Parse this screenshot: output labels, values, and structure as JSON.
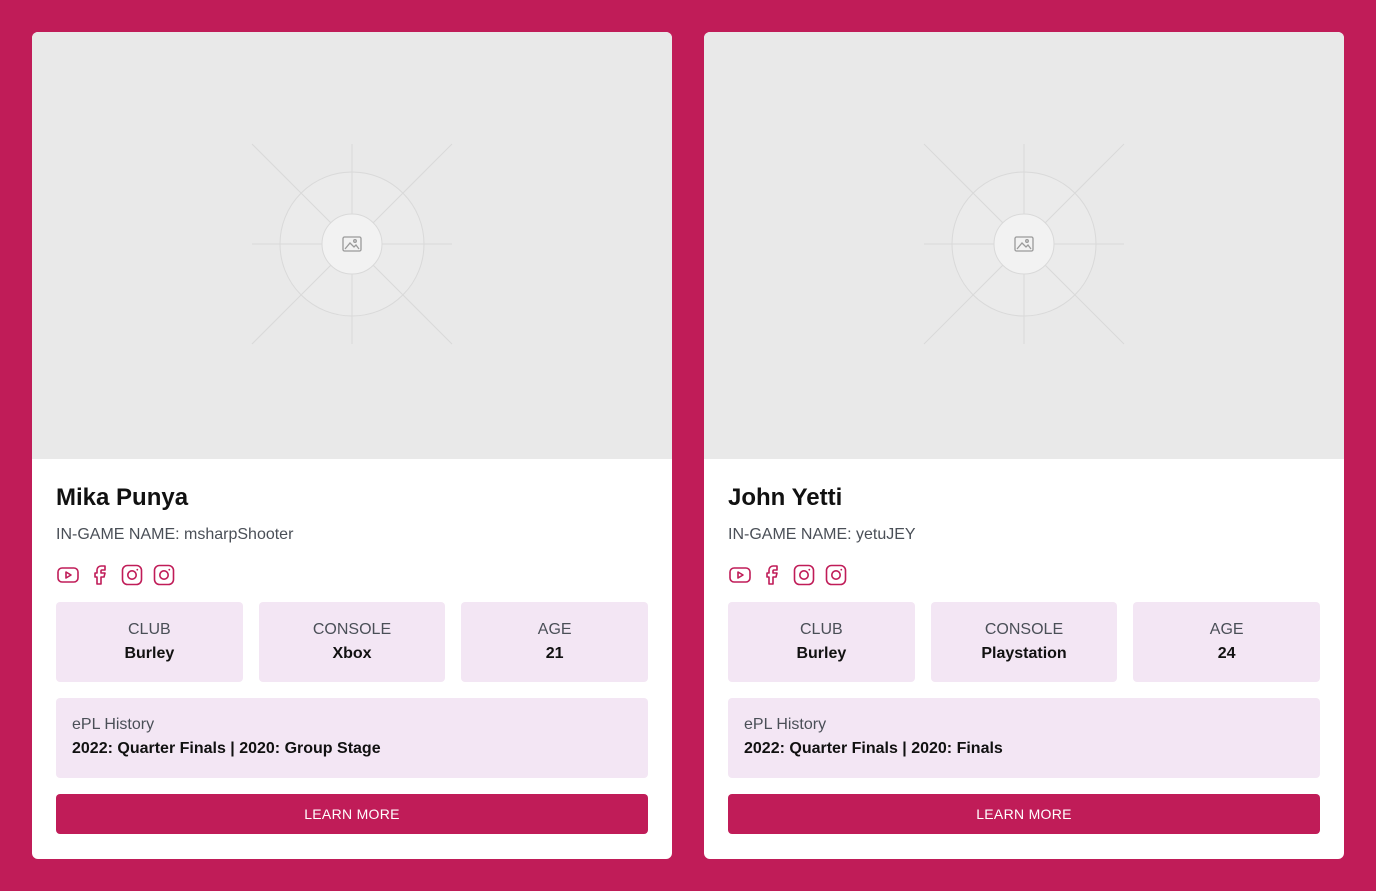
{
  "theme": {
    "background": "#c01c58",
    "accent": "#c01c58",
    "stat_bg": "#f3e6f4",
    "image_placeholder": "#e9e9e9"
  },
  "players": [
    {
      "name": "Mika Punya",
      "ign_label": "IN-GAME NAME:",
      "ign": "msharpShooter",
      "image_icon": "image-placeholder-icon",
      "socials": [
        "youtube-icon",
        "facebook-icon",
        "instagram-icon",
        "instagram-icon"
      ],
      "stats": [
        {
          "label": "CLUB",
          "value": "Burley"
        },
        {
          "label": "CONSOLE",
          "value": "Xbox"
        },
        {
          "label": "AGE",
          "value": "21"
        }
      ],
      "history_label": "ePL History",
      "history_value": "2022: Quarter Finals | 2020: Group Stage",
      "button_label": "LEARN MORE"
    },
    {
      "name": "John Yetti",
      "ign_label": "IN-GAME NAME:",
      "ign": "yetuJEY",
      "image_icon": "image-placeholder-icon",
      "socials": [
        "youtube-icon",
        "facebook-icon",
        "instagram-icon",
        "instagram-icon"
      ],
      "stats": [
        {
          "label": "CLUB",
          "value": "Burley"
        },
        {
          "label": "CONSOLE",
          "value": "Playstation"
        },
        {
          "label": "AGE",
          "value": "24"
        }
      ],
      "history_label": "ePL History",
      "history_value": "2022: Quarter Finals | 2020: Finals",
      "button_label": "LEARN MORE"
    }
  ]
}
